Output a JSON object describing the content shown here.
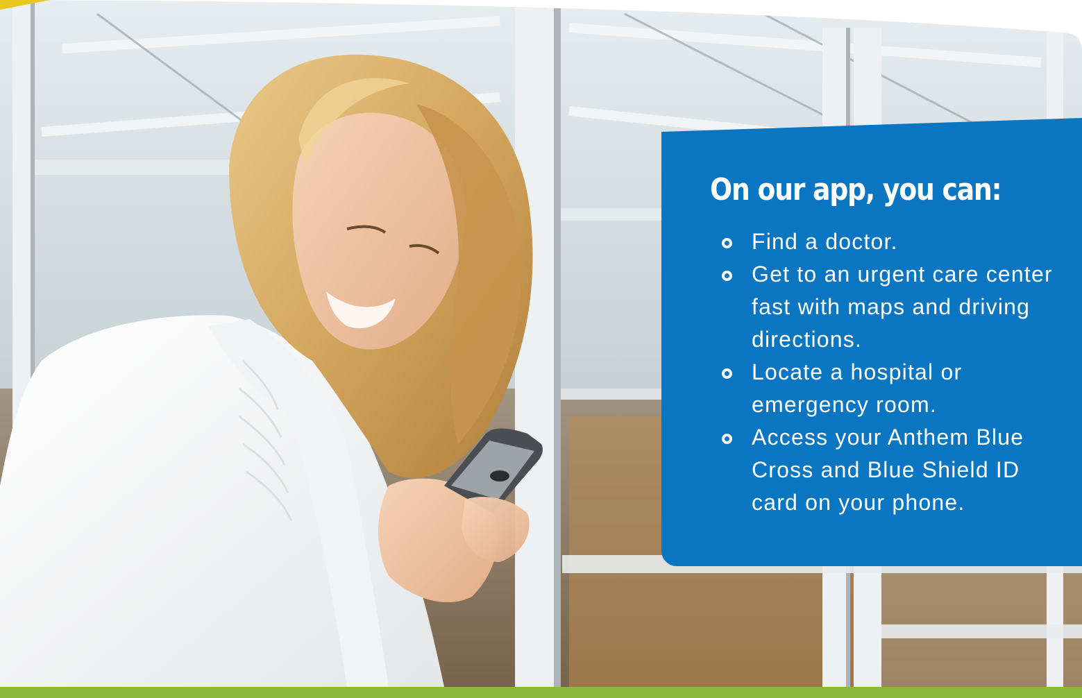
{
  "promo": {
    "heading": "On our app, you can:",
    "features": [
      "Find a doctor.",
      "Get to an urgent care center fast with maps and driving directions.",
      "Locate a hospital or emergency room.",
      "Access your Anthem Blue Cross and Blue Shield ID card on your phone."
    ]
  },
  "colors": {
    "panel_blue": "#0a76c2",
    "accent_green": "#8ab83c",
    "accent_yellow": "#e8c81e",
    "text": "#ffffff"
  },
  "image": {
    "subject": "photo-woman-smiling-using-phone",
    "icon": "bullet-circle-icon"
  }
}
